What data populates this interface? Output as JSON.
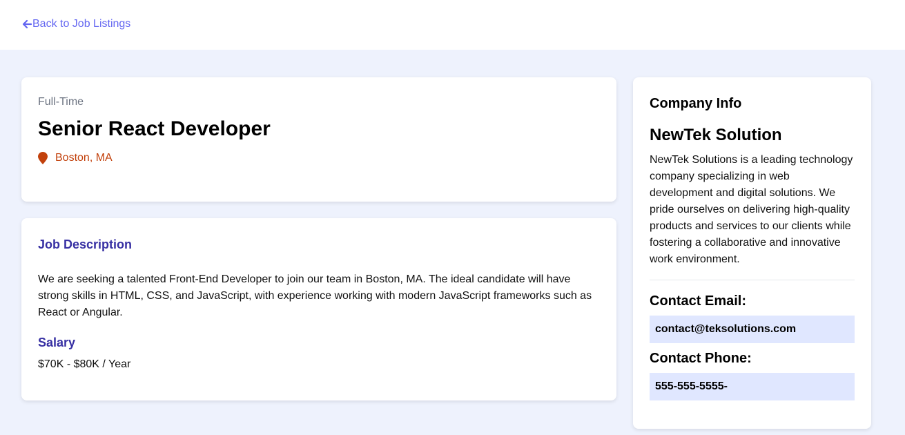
{
  "nav": {
    "back_label": "Back to Job Listings",
    "back_icon": "arrow-left-icon"
  },
  "job": {
    "type": "Full-Time",
    "title": "Senior React Developer",
    "location": "Boston, MA",
    "location_icon": "map-marker-icon",
    "description_heading": "Job Description",
    "description": "We are seeking a talented Front-End Developer to join our team in Boston, MA. The ideal candidate will have strong skills in HTML, CSS, and JavaScript, with experience working with modern JavaScript frameworks such as React or Angular.",
    "salary_heading": "Salary",
    "salary": "$70K - $80K / Year"
  },
  "company": {
    "heading": "Company Info",
    "name": "NewTek Solution",
    "description": "NewTek Solutions is a leading technology company specializing in web development and digital solutions. We pride ourselves on delivering high-quality products and services to our clients while fostering a collaborative and innovative work environment.",
    "email_label": "Contact Email:",
    "email": "contact@teksolutions.com",
    "phone_label": "Contact Phone:",
    "phone": "555-555-5555-"
  },
  "colors": {
    "accent": "#6366f1",
    "heading_indigo": "#3730a3",
    "location_orange": "#c2410c",
    "page_bg": "#eef2fd",
    "contact_bg": "#e0e7ff"
  }
}
